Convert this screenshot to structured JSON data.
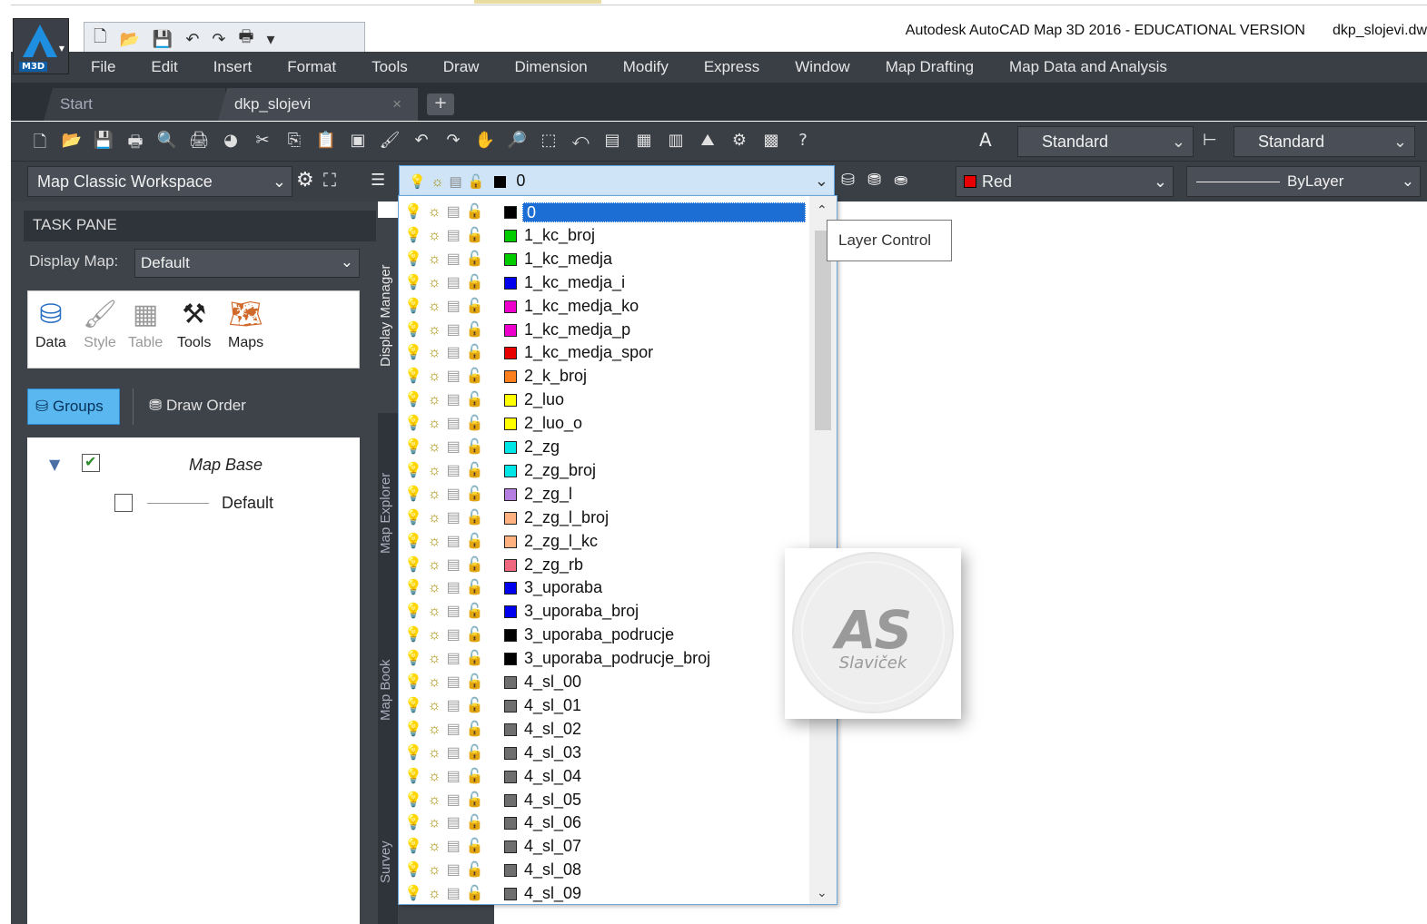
{
  "titlebar": {
    "app_badge": "M3D",
    "title": "Autodesk AutoCAD Map 3D 2016 - EDUCATIONAL VERSION",
    "file": "dkp_slojevi.dw"
  },
  "menu": [
    "File",
    "Edit",
    "Insert",
    "Format",
    "Tools",
    "Draw",
    "Dimension",
    "Modify",
    "Express",
    "Window",
    "Map Drafting",
    "Map Data and Analysis"
  ],
  "tabs": {
    "start": "Start",
    "active": "dkp_slojevi",
    "close": "×",
    "plus": "+"
  },
  "toolbar1": {
    "text_style": "Standard",
    "dim_style": "Standard"
  },
  "toolbar2": {
    "workspace": "Map Classic Workspace",
    "current_layer": "0",
    "color": "Red",
    "color_hex": "#e80000",
    "linetype": "ByLayer"
  },
  "taskpane": {
    "header": "TASK PANE",
    "display_map_label": "Display Map:",
    "display_map_value": "Default",
    "tools": [
      "Data",
      "Style",
      "Table",
      "Tools",
      "Maps"
    ],
    "groups": "Groups",
    "draw_order": "Draw Order",
    "tree": {
      "root": "Map Base",
      "child": "Default"
    },
    "side_tabs": [
      "Display Manager",
      "Map Explorer",
      "Map Book",
      "Survey"
    ]
  },
  "tooltip": "Layer Control",
  "watermark": {
    "initials": "AS",
    "name": "Slaviček"
  },
  "layers": [
    {
      "name": "0",
      "color": "#000000"
    },
    {
      "name": "1_kc_broj",
      "color": "#00cc00"
    },
    {
      "name": "1_kc_medja",
      "color": "#00cc00"
    },
    {
      "name": "1_kc_medja_i",
      "color": "#0000ee"
    },
    {
      "name": "1_kc_medja_ko",
      "color": "#ee00cc"
    },
    {
      "name": "1_kc_medja_p",
      "color": "#ee00cc"
    },
    {
      "name": "1_kc_medja_spor",
      "color": "#e80000"
    },
    {
      "name": "2_k_broj",
      "color": "#ff7f1e"
    },
    {
      "name": "2_luo",
      "color": "#ffff00"
    },
    {
      "name": "2_luo_o",
      "color": "#ffff00"
    },
    {
      "name": "2_zg",
      "color": "#00e5e5"
    },
    {
      "name": "2_zg_broj",
      "color": "#00e5e5"
    },
    {
      "name": "2_zg_l",
      "color": "#b57ee0"
    },
    {
      "name": "2_zg_l_broj",
      "color": "#ffb27f"
    },
    {
      "name": "2_zg_l_kc",
      "color": "#ffb27f"
    },
    {
      "name": "2_zg_rb",
      "color": "#f06880"
    },
    {
      "name": "3_uporaba",
      "color": "#0000ee"
    },
    {
      "name": "3_uporaba_broj",
      "color": "#0000ee"
    },
    {
      "name": "3_uporaba_podrucje",
      "color": "#000000"
    },
    {
      "name": "3_uporaba_podrucje_broj",
      "color": "#000000"
    },
    {
      "name": "4_sl_00",
      "color": "#6e6e6e"
    },
    {
      "name": "4_sl_01",
      "color": "#6e6e6e"
    },
    {
      "name": "4_sl_02",
      "color": "#6e6e6e"
    },
    {
      "name": "4_sl_03",
      "color": "#6e6e6e"
    },
    {
      "name": "4_sl_04",
      "color": "#6e6e6e"
    },
    {
      "name": "4_sl_05",
      "color": "#6e6e6e"
    },
    {
      "name": "4_sl_06",
      "color": "#6e6e6e"
    },
    {
      "name": "4_sl_07",
      "color": "#6e6e6e"
    },
    {
      "name": "4_sl_08",
      "color": "#6e6e6e"
    },
    {
      "name": "4_sl_09",
      "color": "#6e6e6e"
    }
  ]
}
